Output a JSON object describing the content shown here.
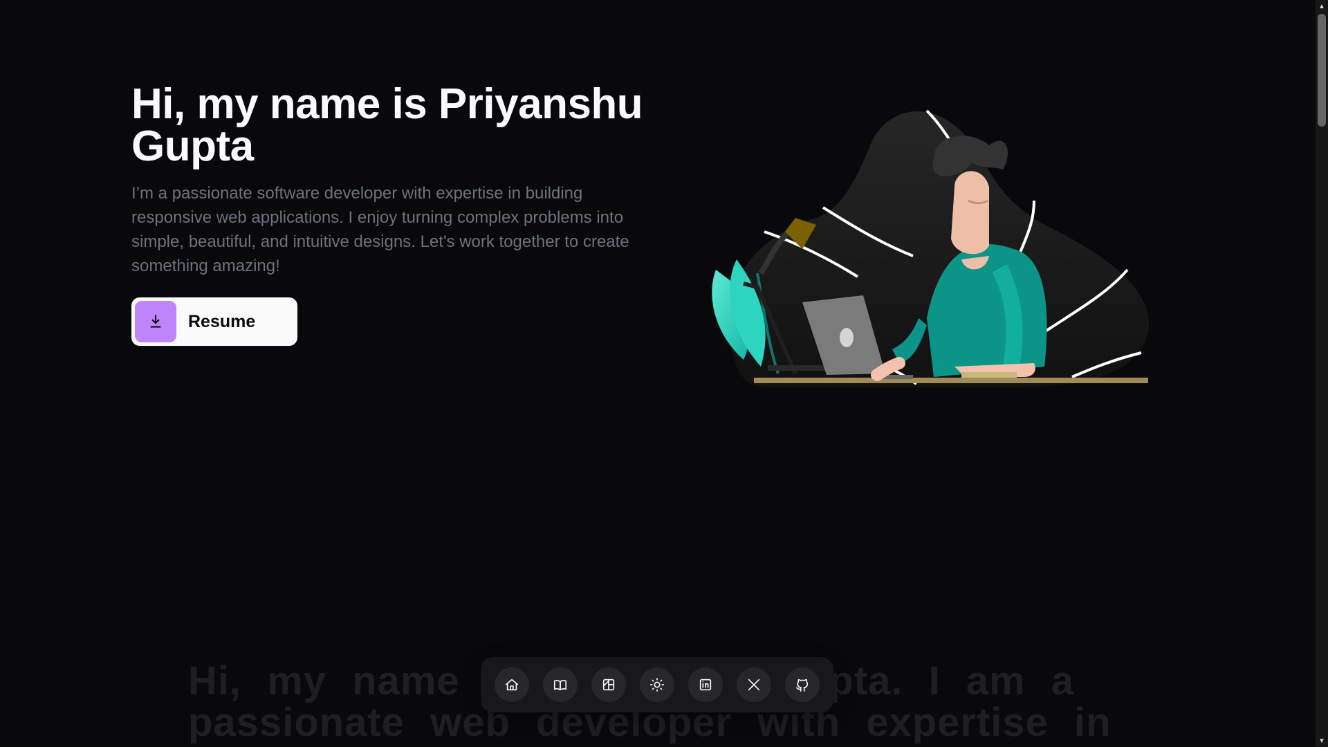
{
  "hero": {
    "title": "Hi, my name is Priyanshu Gupta",
    "description": "I’m a passionate software developer with expertise in building responsive web applications. I enjoy turning complex problems into simple, beautiful, and intuitive designs. Let's work together to create something amazing!",
    "resume_button": {
      "label": "Resume",
      "icon": "download-icon",
      "icon_bg": "#c084fc"
    }
  },
  "illustration": {
    "semantic": "person-working-on-laptop-illustration",
    "colors": {
      "blob": "#232323",
      "shirt": "#0d9488",
      "plant": "#2dd4bf",
      "lamp": "#7a6200",
      "desk": "#a08a57",
      "laptop": "#7b7b7b"
    }
  },
  "marquee": {
    "line1": "Hi, my name is Priyanshu Gupta. I am a",
    "line2": "passionate web developer with expertise in"
  },
  "dock": {
    "items": [
      {
        "name": "home",
        "icon": "home-icon"
      },
      {
        "name": "blog",
        "icon": "book-icon"
      },
      {
        "name": "projects",
        "icon": "layout-icon"
      },
      {
        "name": "theme",
        "icon": "sun-icon"
      },
      {
        "name": "linkedin",
        "icon": "linkedin-icon"
      },
      {
        "name": "x",
        "icon": "x-icon"
      },
      {
        "name": "github",
        "icon": "github-icon"
      }
    ]
  },
  "colors": {
    "background": "#09090b",
    "title": "#f8fafc",
    "description": "#6b7280",
    "dock": "#18181b",
    "dock_button": "#27272a"
  }
}
